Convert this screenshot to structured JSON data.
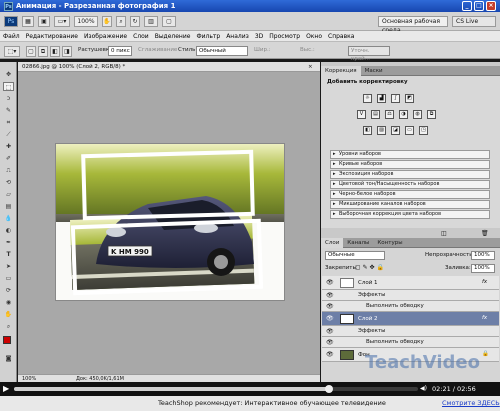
{
  "window": {
    "title": "Анимация - Разрезанная фотография 1",
    "ps_badge": "Ps"
  },
  "appbar": {
    "zoom": "100%",
    "workspace": "Основная рабочая среда",
    "cs_live": "CS Live"
  },
  "menu": [
    "Файл",
    "Редактирование",
    "Изображение",
    "Слои",
    "Выделение",
    "Фильтр",
    "Анализ",
    "3D",
    "Просмотр",
    "Окно",
    "Справка"
  ],
  "options": {
    "feather_label": "Растушевка:",
    "feather_value": "0 пикс",
    "antialias_label": "Сглаживание",
    "style_label": "Стиль:",
    "style_value": "Обычный",
    "width_label": "Шир.:",
    "height_label": "Выс.:",
    "refine_label": "Уточн. край..."
  },
  "document": {
    "tab": "02866.jpg @ 100% (Слой 2, RGB/8) *",
    "zoom": "100%",
    "status": "Док: 450,0K/1,61M",
    "plate_text": "K HM 990"
  },
  "adjustments": {
    "tabs": [
      "Коррекция",
      "Маски"
    ],
    "title": "Добавить корректировку",
    "presets": [
      "Уровни наборов",
      "Кривые наборов",
      "Экспозиция наборов",
      "Цветовой тон/Насыщенность наборов",
      "Черно-белое наборов",
      "Микширование каналов наборов",
      "Выборочная коррекция цвета наборов"
    ]
  },
  "layers": {
    "tabs": [
      "Слои",
      "Каналы",
      "Контуры"
    ],
    "blend_mode": "Обычные",
    "opacity_label": "Непрозрачность:",
    "opacity_value": "100%",
    "lock_label": "Закрепить:",
    "fill_label": "Заливка:",
    "fill_value": "100%",
    "items": [
      {
        "name": "Слой 1",
        "fx": "fx"
      },
      {
        "name": "Эффекты"
      },
      {
        "name": "Выполнить обводку"
      },
      {
        "name": "Слой 2",
        "fx": "fx"
      },
      {
        "name": "Эффекты"
      },
      {
        "name": "Выполнить обводку"
      },
      {
        "name": "Фон"
      }
    ]
  },
  "watermark": "TeachVideo",
  "player": {
    "time": "02:21 / 02:56",
    "progress": 0.78
  },
  "footer": {
    "text": "TeachShop рекомендует: Интерактивное обучающее телевидение",
    "link": "Смотрите ЗДЕСЬ"
  },
  "colors": {
    "accent": "#2f6ad8",
    "foreground_swatch": "#cc0000",
    "background_swatch": "#ffffff",
    "link": "#1a3cc8"
  }
}
